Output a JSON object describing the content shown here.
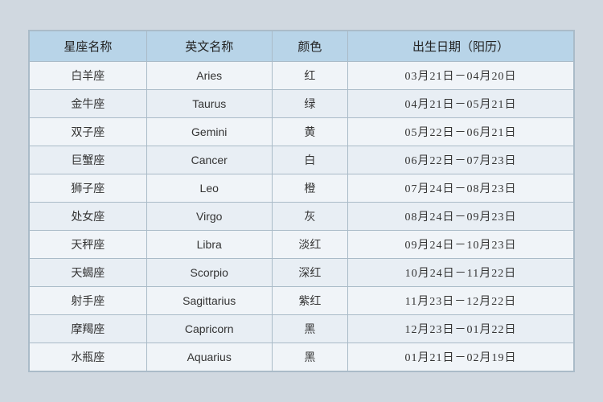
{
  "table": {
    "headers": [
      {
        "key": "col-chinese-name",
        "label": "星座名称"
      },
      {
        "key": "col-english-name",
        "label": "英文名称"
      },
      {
        "key": "col-color",
        "label": "颜色"
      },
      {
        "key": "col-birthday",
        "label": "出生日期（阳历）"
      }
    ],
    "rows": [
      {
        "chinese": "白羊座",
        "english": "Aries",
        "color": "红",
        "date": "03月21日－04月20日"
      },
      {
        "chinese": "金牛座",
        "english": "Taurus",
        "color": "绿",
        "date": "04月21日－05月21日"
      },
      {
        "chinese": "双子座",
        "english": "Gemini",
        "color": "黄",
        "date": "05月22日－06月21日"
      },
      {
        "chinese": "巨蟹座",
        "english": "Cancer",
        "color": "白",
        "date": "06月22日－07月23日"
      },
      {
        "chinese": "狮子座",
        "english": "Leo",
        "color": "橙",
        "date": "07月24日－08月23日"
      },
      {
        "chinese": "处女座",
        "english": "Virgo",
        "color": "灰",
        "date": "08月24日－09月23日"
      },
      {
        "chinese": "天秤座",
        "english": "Libra",
        "color": "淡红",
        "date": "09月24日－10月23日"
      },
      {
        "chinese": "天蝎座",
        "english": "Scorpio",
        "color": "深红",
        "date": "10月24日－11月22日"
      },
      {
        "chinese": "射手座",
        "english": "Sagittarius",
        "color": "紫红",
        "date": "11月23日－12月22日"
      },
      {
        "chinese": "摩羯座",
        "english": "Capricorn",
        "color": "黑",
        "date": "12月23日－01月22日"
      },
      {
        "chinese": "水瓶座",
        "english": "Aquarius",
        "color": "黑",
        "date": "01月21日－02月19日"
      }
    ]
  }
}
